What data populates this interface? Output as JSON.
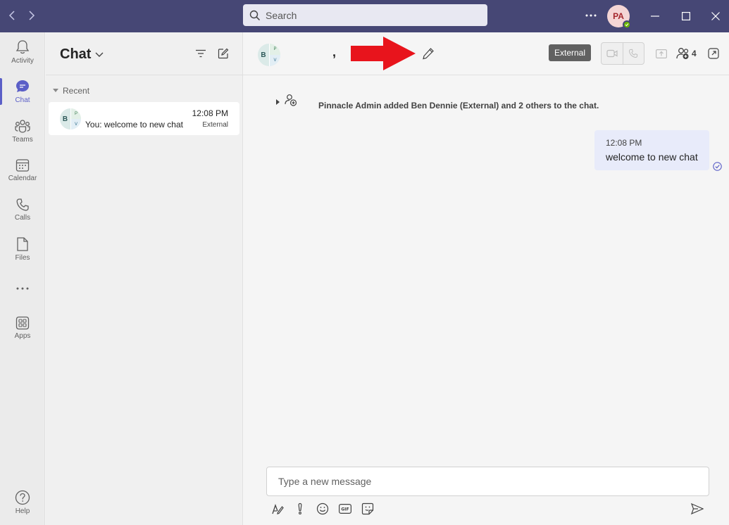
{
  "colors": {
    "brand": "#464775",
    "accent": "#5b5fc7"
  },
  "titlebar": {
    "search_placeholder": "Search",
    "user_initials": "PA"
  },
  "rail": {
    "items": [
      {
        "label": "Activity",
        "icon": "bell-icon"
      },
      {
        "label": "Chat",
        "icon": "chat-icon"
      },
      {
        "label": "Teams",
        "icon": "teams-icon"
      },
      {
        "label": "Calendar",
        "icon": "calendar-icon"
      },
      {
        "label": "Calls",
        "icon": "phone-icon"
      },
      {
        "label": "Files",
        "icon": "file-icon"
      },
      {
        "label": "Apps",
        "icon": "apps-icon"
      },
      {
        "label": "Help",
        "icon": "help-icon"
      }
    ]
  },
  "chatlist": {
    "title": "Chat",
    "section": "Recent",
    "chats": [
      {
        "avatar": {
          "b": "B",
          "p": "P",
          "v": "V"
        },
        "preview": "You: welcome to new chat",
        "time": "12:08 PM",
        "tag": "External"
      }
    ]
  },
  "main": {
    "avatar": {
      "b": "B",
      "p": "P",
      "v": "V"
    },
    "chat_name": ",",
    "external_label": "External",
    "participants_count": "4",
    "system_message": "Pinnacle Admin added Ben Dennie (External) and 2 others to the chat.",
    "messages": [
      {
        "time": "12:08 PM",
        "text": "welcome to new chat"
      }
    ],
    "composer_placeholder": "Type a new message"
  }
}
